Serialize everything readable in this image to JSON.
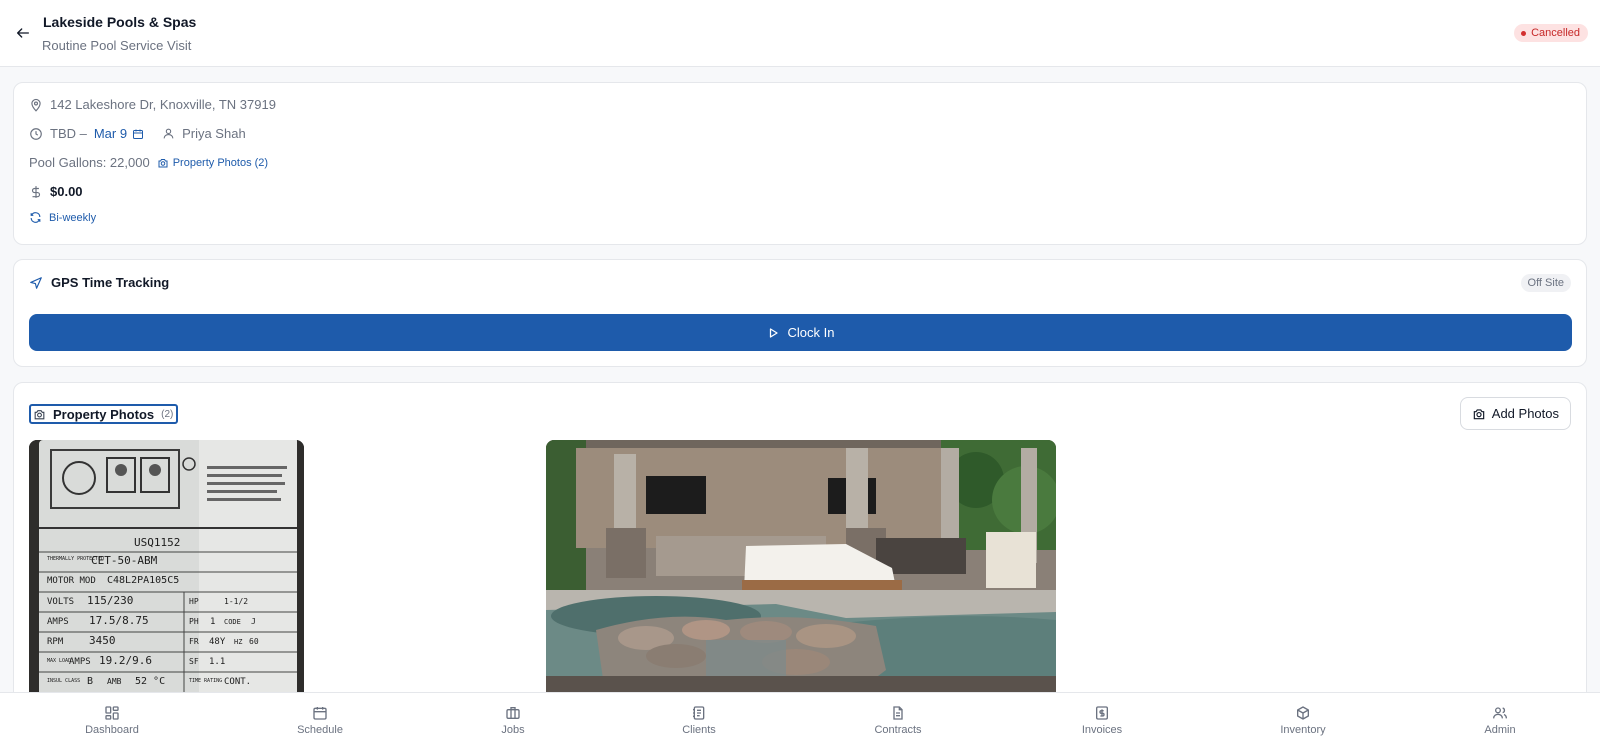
{
  "header": {
    "title": "Lakeside Pools & Spas",
    "subtitle": "Routine Pool Service Visit",
    "status": "Cancelled",
    "back_icon": "arrow-left-icon"
  },
  "details": {
    "address": "142 Lakeshore Dr, Knoxville, TN 37919",
    "time_prefix": "TBD –",
    "date": "Mar 9",
    "technician": "Priya Shah",
    "pool_gallons": "Pool Gallons: 22,000",
    "photos_link": "Property Photos (2)",
    "price": "$0.00",
    "recurrence": "Bi-weekly"
  },
  "gps": {
    "title": "GPS Time Tracking",
    "status": "Off Site",
    "button_label": "Clock In"
  },
  "photos": {
    "title": "Property Photos",
    "count": "(2)",
    "add_button": "Add Photos",
    "plate": {
      "model": "USQ1152",
      "protected_label": "THERMALLY PROTECTED",
      "protected_value": "CET-50-ABM",
      "motor_mod_label": "MOTOR MOD",
      "motor_mod_value": "C48L2PA105C5",
      "volts_label": "VOLTS",
      "volts_value": "115/230",
      "hp_label": "HP",
      "hp_value": "1-1/2",
      "amps_label": "AMPS",
      "amps_value": "17.5/8.75",
      "ph_label": "PH",
      "ph_value": "1",
      "code_label": "CODE",
      "code_value": "J",
      "rpm_label": "RPM",
      "rpm_value": "3450",
      "fr_label": "FR",
      "fr_value": "48Y",
      "hz_label": "HZ",
      "hz_value": "60",
      "maxload_label": "MAX LOAD",
      "maxamps_label": "AMPS",
      "maxamps_value": "19.2/9.6",
      "sf_label": "SF",
      "sf_value": "1.1",
      "insul_label": "INSUL CLASS",
      "insul_value": "B",
      "amb_label": "AMB",
      "amb_value": "52 °C",
      "time_label": "TIME RATING",
      "time_value": "CONT."
    }
  },
  "nav": [
    {
      "label": "Dashboard",
      "icon": "dashboard-grid-icon"
    },
    {
      "label": "Schedule",
      "icon": "calendar-icon"
    },
    {
      "label": "Jobs",
      "icon": "briefcase-icon"
    },
    {
      "label": "Clients",
      "icon": "contacts-icon"
    },
    {
      "label": "Contracts",
      "icon": "document-icon"
    },
    {
      "label": "Invoices",
      "icon": "invoice-dollar-icon"
    },
    {
      "label": "Inventory",
      "icon": "box-icon"
    },
    {
      "label": "Admin",
      "icon": "users-icon"
    }
  ],
  "colors": {
    "accent": "#1e5bab",
    "danger": "#c62828",
    "danger_bg": "#fde2e2"
  }
}
